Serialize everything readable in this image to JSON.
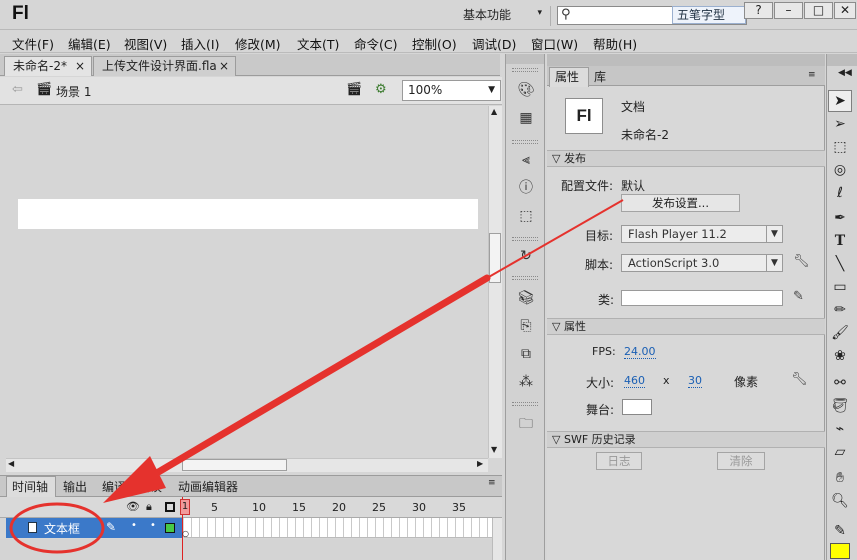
{
  "app": {
    "logo": "Fl",
    "workspace": "基本功能",
    "ime": "五笔字型",
    "window_buttons": [
      "?",
      "–",
      "□",
      "✕"
    ]
  },
  "menu": [
    "文件(F)",
    "编辑(E)",
    "视图(V)",
    "插入(I)",
    "修改(M)",
    "文本(T)",
    "命令(C)",
    "控制(O)",
    "调试(D)",
    "窗口(W)",
    "帮助(H)"
  ],
  "doc_tabs": [
    {
      "label": "未命名-2*",
      "close": "×"
    },
    {
      "label": "上传文件设计界面.fla",
      "close": "×"
    }
  ],
  "stage_bar": {
    "scene": "场景 1",
    "zoom": "100%"
  },
  "timeline": {
    "tabs": [
      "时间轴",
      "输出",
      "编译器错误",
      "动画编辑器"
    ],
    "frame_numbers": [
      "1",
      "5",
      "10",
      "15",
      "20",
      "25",
      "30",
      "35"
    ],
    "layer_name": "文本框",
    "playhead_frame": "1"
  },
  "properties": {
    "tabs": [
      "属性",
      "库"
    ],
    "doc_type": "文档",
    "doc_name": "未命名-2",
    "icon_text": "Fl",
    "publish": {
      "header": "发布",
      "profile_label": "配置文件:",
      "profile_value": "默认",
      "settings_button": "发布设置...",
      "target_label": "目标:",
      "target_value": "Flash Player 11.2",
      "script_label": "脚本:",
      "script_value": "ActionScript 3.0",
      "class_label": "类:"
    },
    "props": {
      "header": "属性",
      "fps_label": "FPS:",
      "fps_value": "24.00",
      "size_label": "大小:",
      "width": "460",
      "x": "x",
      "height": "30",
      "unit": "像素",
      "stage_label": "舞台:"
    },
    "history": {
      "header": "SWF 历史记录",
      "log_button": "日志",
      "clear_button": "清除"
    }
  },
  "colors": {
    "layer_highlight": "#3b79c9",
    "fill_swatch": "#ffff00",
    "annotation": "#e5322d"
  }
}
